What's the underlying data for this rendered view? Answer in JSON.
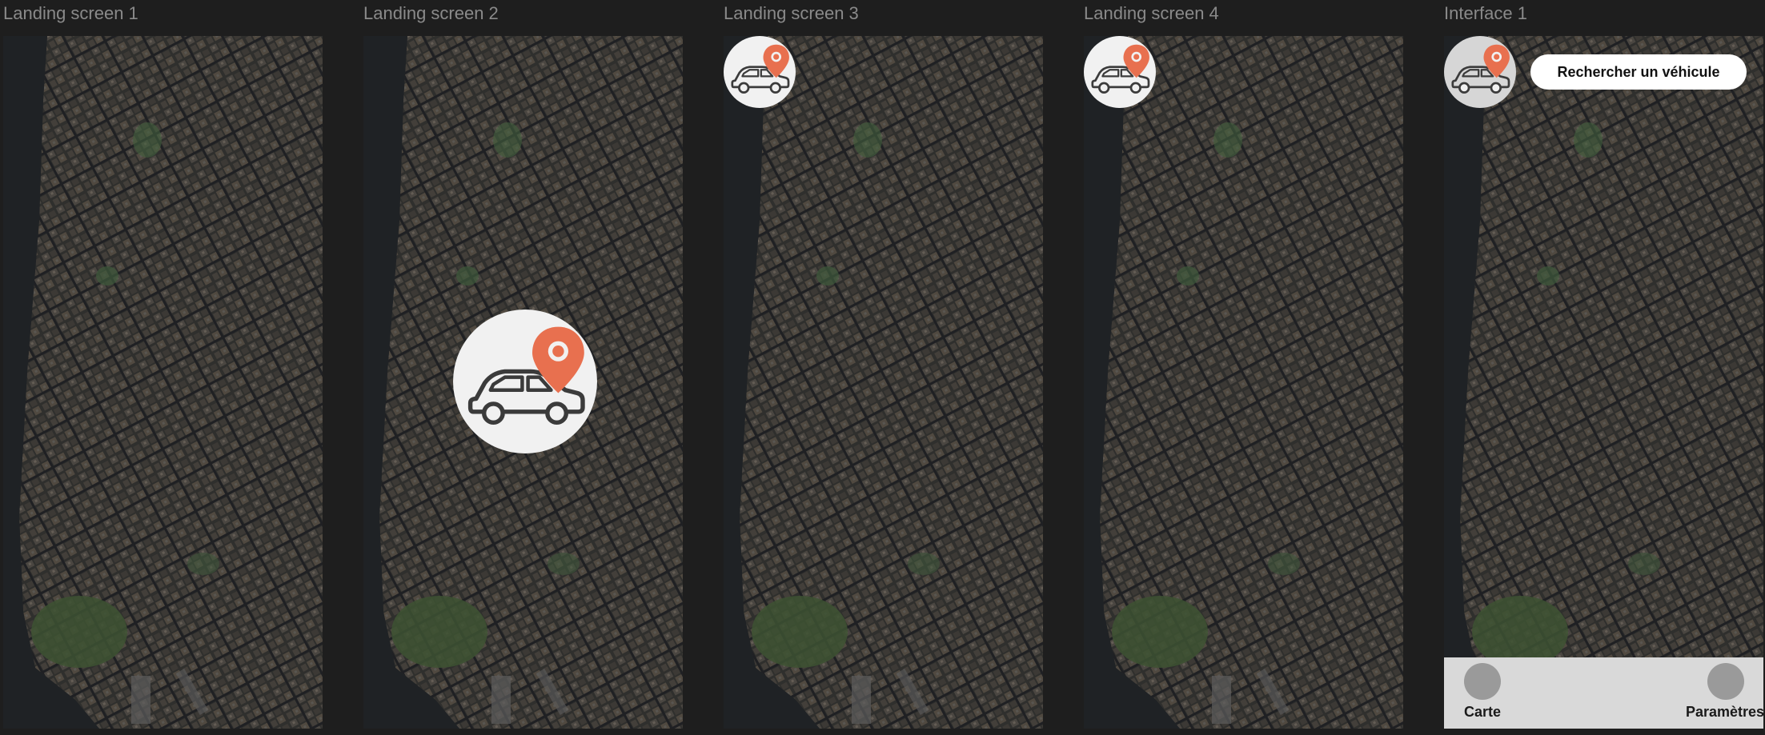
{
  "frames": [
    {
      "label": "Landing screen 1"
    },
    {
      "label": "Landing screen 2"
    },
    {
      "label": "Landing screen 3"
    },
    {
      "label": "Landing screen 4"
    },
    {
      "label": "Interface 1"
    }
  ],
  "interface": {
    "search_label": "Rechercher un véhicule",
    "nav": {
      "map_label": "Carte",
      "settings_label": "Paramètres"
    }
  },
  "icons": {
    "logo": "car-location-icon",
    "nav_map": "map-icon",
    "nav_settings": "settings-icon"
  },
  "colors": {
    "canvas_bg": "#1e1e1e",
    "frame_label": "#8a8a8a",
    "pin": "#e8704f",
    "logo_bg": "#f1f1f1",
    "logo_stroke": "#3b3b3b",
    "nav_bar": "#d9d9d9",
    "nav_dot": "#9a9a9a"
  }
}
